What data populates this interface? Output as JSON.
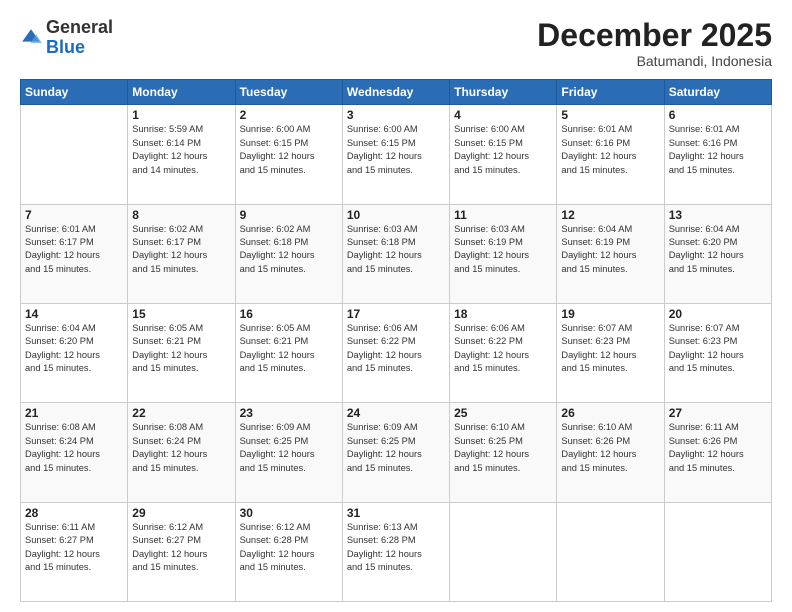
{
  "header": {
    "logo": {
      "line1": "General",
      "line2": "Blue"
    },
    "title": "December 2025",
    "location": "Batumandi, Indonesia"
  },
  "weekdays": [
    "Sunday",
    "Monday",
    "Tuesday",
    "Wednesday",
    "Thursday",
    "Friday",
    "Saturday"
  ],
  "weeks": [
    [
      {
        "day": "",
        "info": ""
      },
      {
        "day": "1",
        "info": "Sunrise: 5:59 AM\nSunset: 6:14 PM\nDaylight: 12 hours\nand 14 minutes."
      },
      {
        "day": "2",
        "info": "Sunrise: 6:00 AM\nSunset: 6:15 PM\nDaylight: 12 hours\nand 15 minutes."
      },
      {
        "day": "3",
        "info": "Sunrise: 6:00 AM\nSunset: 6:15 PM\nDaylight: 12 hours\nand 15 minutes."
      },
      {
        "day": "4",
        "info": "Sunrise: 6:00 AM\nSunset: 6:15 PM\nDaylight: 12 hours\nand 15 minutes."
      },
      {
        "day": "5",
        "info": "Sunrise: 6:01 AM\nSunset: 6:16 PM\nDaylight: 12 hours\nand 15 minutes."
      },
      {
        "day": "6",
        "info": "Sunrise: 6:01 AM\nSunset: 6:16 PM\nDaylight: 12 hours\nand 15 minutes."
      }
    ],
    [
      {
        "day": "7",
        "info": ""
      },
      {
        "day": "8",
        "info": "Sunrise: 6:02 AM\nSunset: 6:17 PM\nDaylight: 12 hours\nand 15 minutes."
      },
      {
        "day": "9",
        "info": "Sunrise: 6:02 AM\nSunset: 6:18 PM\nDaylight: 12 hours\nand 15 minutes."
      },
      {
        "day": "10",
        "info": "Sunrise: 6:03 AM\nSunset: 6:18 PM\nDaylight: 12 hours\nand 15 minutes."
      },
      {
        "day": "11",
        "info": "Sunrise: 6:03 AM\nSunset: 6:19 PM\nDaylight: 12 hours\nand 15 minutes."
      },
      {
        "day": "12",
        "info": "Sunrise: 6:04 AM\nSunset: 6:19 PM\nDaylight: 12 hours\nand 15 minutes."
      },
      {
        "day": "13",
        "info": "Sunrise: 6:04 AM\nSunset: 6:20 PM\nDaylight: 12 hours\nand 15 minutes."
      }
    ],
    [
      {
        "day": "14",
        "info": ""
      },
      {
        "day": "15",
        "info": "Sunrise: 6:05 AM\nSunset: 6:21 PM\nDaylight: 12 hours\nand 15 minutes."
      },
      {
        "day": "16",
        "info": "Sunrise: 6:05 AM\nSunset: 6:21 PM\nDaylight: 12 hours\nand 15 minutes."
      },
      {
        "day": "17",
        "info": "Sunrise: 6:06 AM\nSunset: 6:22 PM\nDaylight: 12 hours\nand 15 minutes."
      },
      {
        "day": "18",
        "info": "Sunrise: 6:06 AM\nSunset: 6:22 PM\nDaylight: 12 hours\nand 15 minutes."
      },
      {
        "day": "19",
        "info": "Sunrise: 6:07 AM\nSunset: 6:23 PM\nDaylight: 12 hours\nand 15 minutes."
      },
      {
        "day": "20",
        "info": "Sunrise: 6:07 AM\nSunset: 6:23 PM\nDaylight: 12 hours\nand 15 minutes."
      }
    ],
    [
      {
        "day": "21",
        "info": ""
      },
      {
        "day": "22",
        "info": "Sunrise: 6:08 AM\nSunset: 6:24 PM\nDaylight: 12 hours\nand 15 minutes."
      },
      {
        "day": "23",
        "info": "Sunrise: 6:09 AM\nSunset: 6:25 PM\nDaylight: 12 hours\nand 15 minutes."
      },
      {
        "day": "24",
        "info": "Sunrise: 6:09 AM\nSunset: 6:25 PM\nDaylight: 12 hours\nand 15 minutes."
      },
      {
        "day": "25",
        "info": "Sunrise: 6:10 AM\nSunset: 6:25 PM\nDaylight: 12 hours\nand 15 minutes."
      },
      {
        "day": "26",
        "info": "Sunrise: 6:10 AM\nSunset: 6:26 PM\nDaylight: 12 hours\nand 15 minutes."
      },
      {
        "day": "27",
        "info": "Sunrise: 6:11 AM\nSunset: 6:26 PM\nDaylight: 12 hours\nand 15 minutes."
      }
    ],
    [
      {
        "day": "28",
        "info": "Sunrise: 6:11 AM\nSunset: 6:27 PM\nDaylight: 12 hours\nand 15 minutes."
      },
      {
        "day": "29",
        "info": "Sunrise: 6:12 AM\nSunset: 6:27 PM\nDaylight: 12 hours\nand 15 minutes."
      },
      {
        "day": "30",
        "info": "Sunrise: 6:12 AM\nSunset: 6:28 PM\nDaylight: 12 hours\nand 15 minutes."
      },
      {
        "day": "31",
        "info": "Sunrise: 6:13 AM\nSunset: 6:28 PM\nDaylight: 12 hours\nand 15 minutes."
      },
      {
        "day": "",
        "info": ""
      },
      {
        "day": "",
        "info": ""
      },
      {
        "day": "",
        "info": ""
      }
    ]
  ],
  "day_info_overrides": {
    "7": "Sunrise: 6:01 AM\nSunset: 6:17 PM\nDaylight: 12 hours\nand 15 minutes.",
    "14": "Sunrise: 6:04 AM\nSunset: 6:20 PM\nDaylight: 12 hours\nand 15 minutes.",
    "21": "Sunrise: 6:08 AM\nSunset: 6:24 PM\nDaylight: 12 hours\nand 15 minutes."
  }
}
